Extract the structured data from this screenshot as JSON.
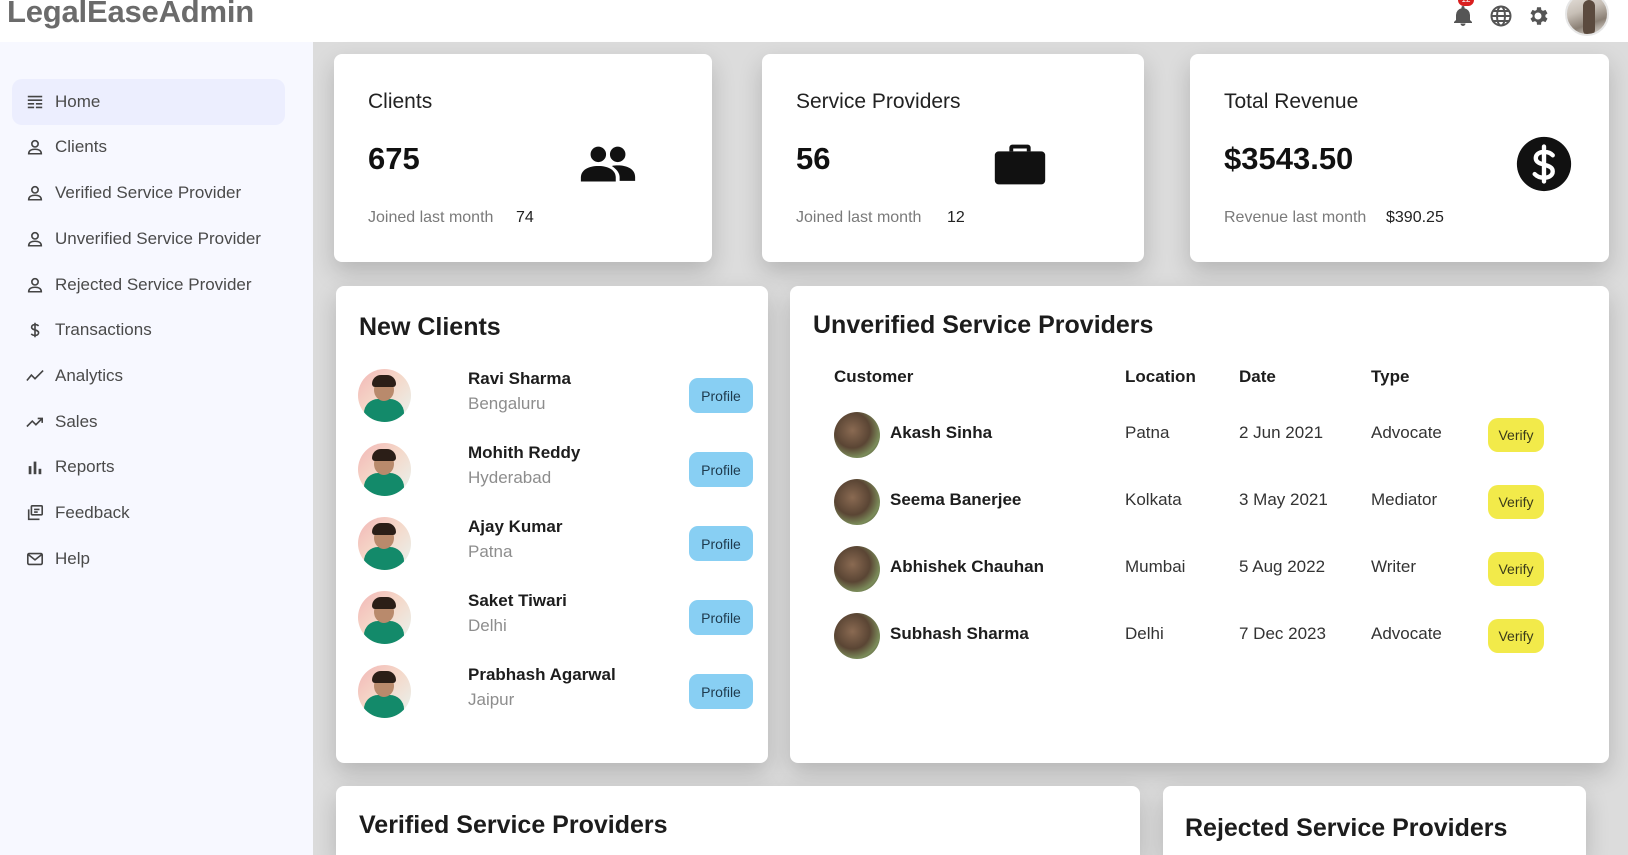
{
  "app": {
    "brand": "LegalEaseAdmin"
  },
  "header": {
    "notification_count": "12",
    "icons": [
      "bell-icon",
      "globe-icon",
      "gear-icon"
    ]
  },
  "sidebar": {
    "items": [
      {
        "label": "Home",
        "icon": "dashboard-icon",
        "active": true
      },
      {
        "label": "Clients",
        "icon": "person-icon"
      },
      {
        "label": "Verified Service Provider",
        "icon": "person-icon"
      },
      {
        "label": "Unverified Service Provider",
        "icon": "person-icon"
      },
      {
        "label": "Rejected Service Provider",
        "icon": "person-icon"
      },
      {
        "label": "Transactions",
        "icon": "dollar-icon"
      },
      {
        "label": "Analytics",
        "icon": "trend-line-icon"
      },
      {
        "label": "Sales",
        "icon": "trend-up-icon"
      },
      {
        "label": "Reports",
        "icon": "bar-chart-icon"
      },
      {
        "label": "Feedback",
        "icon": "feedback-icon"
      },
      {
        "label": "Help",
        "icon": "mail-icon"
      }
    ]
  },
  "stats": {
    "clients": {
      "title": "Clients",
      "value": "675",
      "sub_label": "Joined last month",
      "sub_value": "74",
      "icon": "group-icon"
    },
    "providers": {
      "title": "Service Providers",
      "value": "56",
      "sub_label": "Joined last month",
      "sub_value": "12",
      "icon": "briefcase-icon"
    },
    "revenue": {
      "title": "Total Revenue",
      "value": "$3543.50",
      "sub_label": "Revenue last month",
      "sub_value": "$390.25",
      "icon": "dollar-circle-icon"
    }
  },
  "new_clients": {
    "title": "New Clients",
    "button_label": "Profile",
    "rows": [
      {
        "name": "Ravi Sharma",
        "city": "Bengaluru"
      },
      {
        "name": "Mohith Reddy",
        "city": "Hyderabad"
      },
      {
        "name": "Ajay Kumar",
        "city": "Patna"
      },
      {
        "name": "Saket Tiwari",
        "city": "Delhi"
      },
      {
        "name": "Prabhash Agarwal",
        "city": "Jaipur"
      }
    ]
  },
  "unverified": {
    "title": "Unverified Service Providers",
    "columns": {
      "customer": "Customer",
      "location": "Location",
      "date": "Date",
      "type": "Type"
    },
    "button_label": "Verify",
    "rows": [
      {
        "name": "Akash Sinha",
        "location": "Patna",
        "date": "2 Jun 2021",
        "type": "Advocate"
      },
      {
        "name": "Seema Banerjee",
        "location": "Kolkata",
        "date": "3 May 2021",
        "type": "Mediator"
      },
      {
        "name": "Abhishek Chauhan",
        "location": "Mumbai",
        "date": "5 Aug 2022",
        "type": "Writer"
      },
      {
        "name": "Subhash Sharma",
        "location": "Delhi",
        "date": "7 Dec 2023",
        "type": "Advocate"
      }
    ]
  },
  "verified": {
    "title": "Verified Service Providers"
  },
  "rejected": {
    "title": "Rejected Service Providers"
  }
}
